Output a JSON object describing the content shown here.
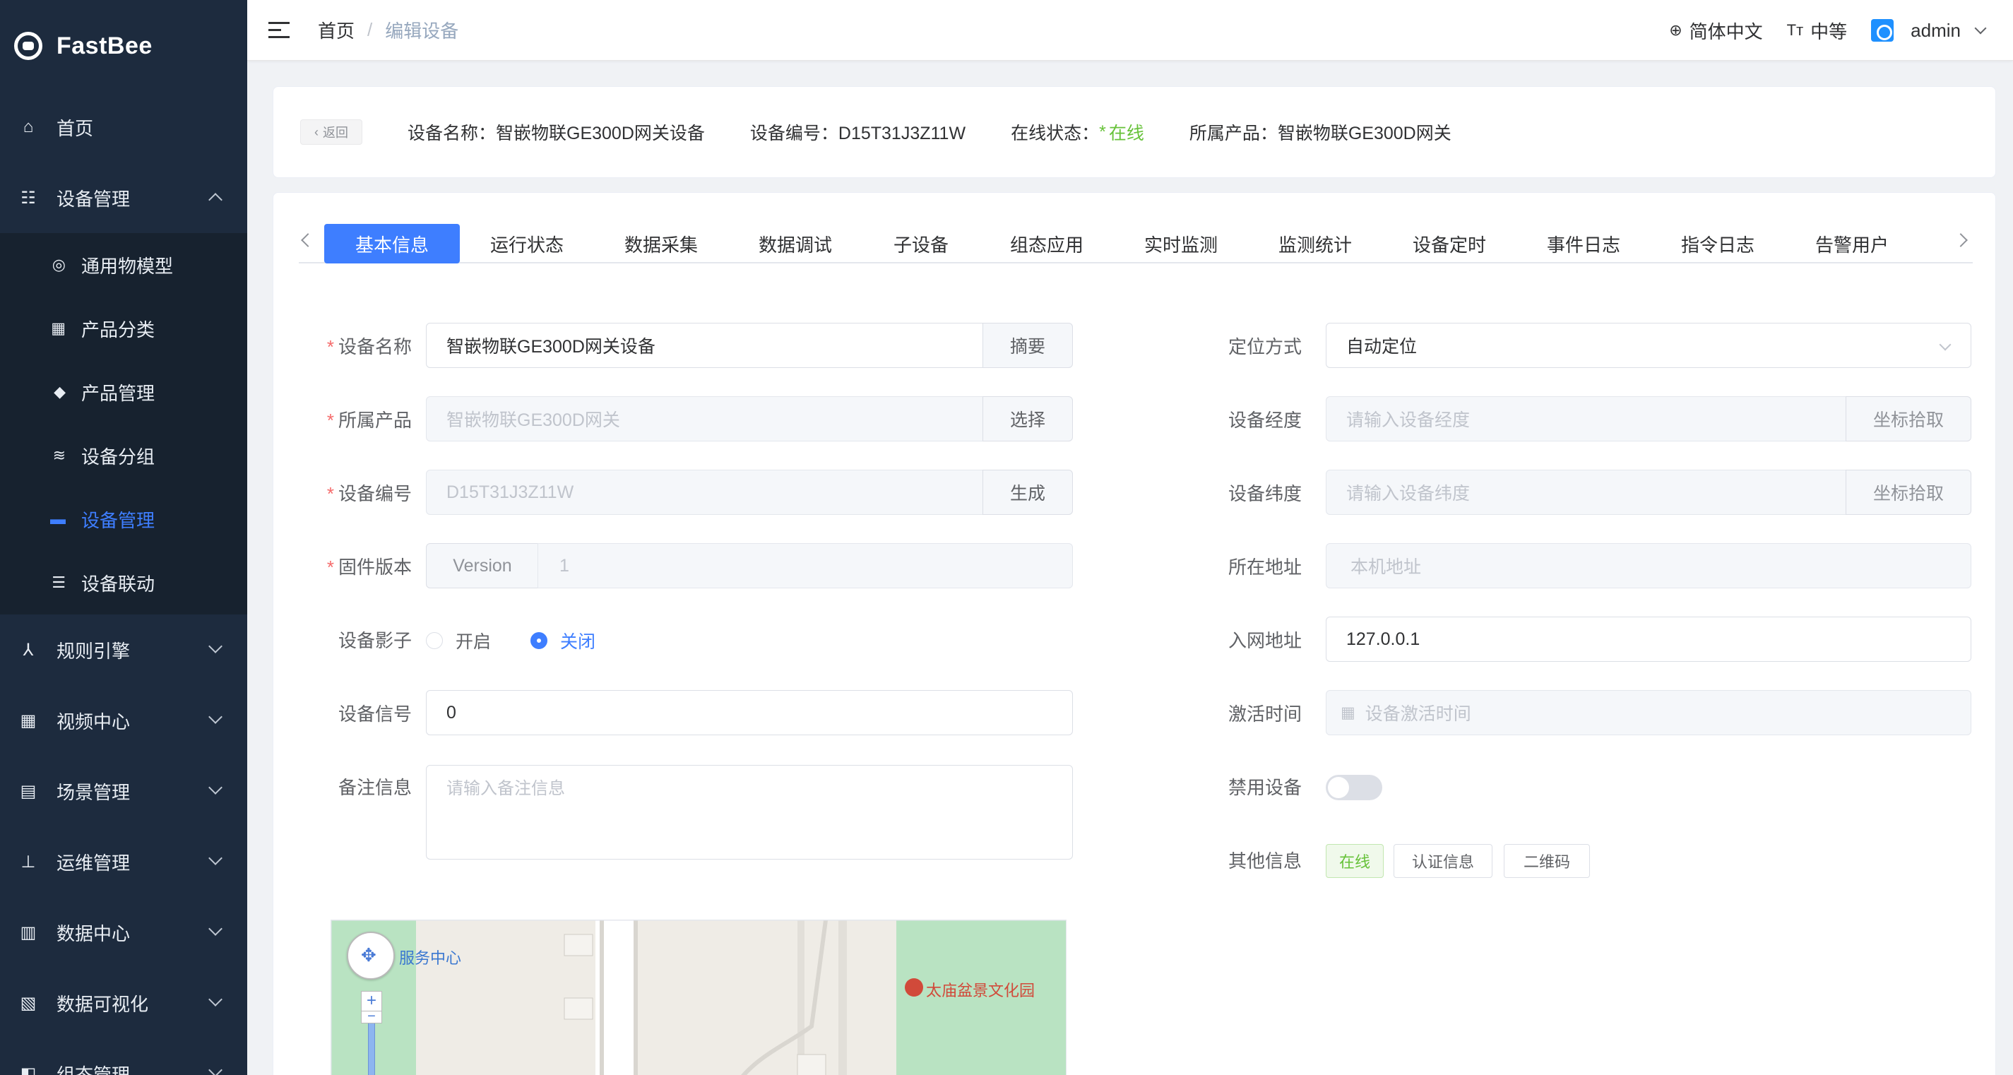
{
  "app": {
    "name": "FastBee"
  },
  "sidebar": {
    "items": [
      {
        "label": "首页",
        "icon": "home-icon"
      },
      {
        "label": "设备管理",
        "icon": "device-icon",
        "expanded": true
      },
      {
        "label": "通用物模型",
        "icon": "model-icon"
      },
      {
        "label": "产品分类",
        "icon": "category-icon"
      },
      {
        "label": "产品管理",
        "icon": "box-icon"
      },
      {
        "label": "设备分组",
        "icon": "layers-icon"
      },
      {
        "label": "设备管理",
        "icon": "device-manage-icon",
        "active": true
      },
      {
        "label": "设备联动",
        "icon": "list-icon"
      },
      {
        "label": "规则引擎",
        "icon": "rule-icon"
      },
      {
        "label": "视频中心",
        "icon": "video-icon"
      },
      {
        "label": "场景管理",
        "icon": "scene-icon"
      },
      {
        "label": "运维管理",
        "icon": "ops-icon"
      },
      {
        "label": "数据中心",
        "icon": "data-icon"
      },
      {
        "label": "数据可视化",
        "icon": "visual-icon"
      },
      {
        "label": "组态管理",
        "icon": "config-icon"
      }
    ]
  },
  "header": {
    "breadcrumb": {
      "home": "首页",
      "current": "编辑设备"
    },
    "language": "简体中文",
    "font_size": "中等",
    "user": "admin"
  },
  "info": {
    "back": "返回",
    "device_name": "设备名称：智嵌物联GE300D网关设备",
    "device_code": "设备编号：D15T31J3Z11W",
    "online_label": "在线状态：",
    "online_value": "在线",
    "product": "所属产品：智嵌物联GE300D网关"
  },
  "tabs": [
    "基本信息",
    "运行状态",
    "数据采集",
    "数据调试",
    "子设备",
    "组态应用",
    "实时监测",
    "监测统计",
    "设备定时",
    "事件日志",
    "指令日志",
    "告警用户"
  ],
  "form_left": {
    "device_name_label": "设备名称",
    "device_name_value": "智嵌物联GE300D网关设备",
    "summary_btn": "摘要",
    "product_label": "所属产品",
    "product_value": "智嵌物联GE300D网关",
    "select_btn": "选择",
    "serial_label": "设备编号",
    "serial_value": "D15T31J3Z11W",
    "generate_btn": "生成",
    "firmware_label": "固件版本",
    "firmware_prefix": "Version",
    "firmware_value": "1",
    "shadow_label": "设备影子",
    "shadow_on": "开启",
    "shadow_off": "关闭",
    "signal_label": "设备信号",
    "signal_value": "0",
    "remark_label": "备注信息",
    "remark_placeholder": "请输入备注信息"
  },
  "form_right": {
    "locate_label": "定位方式",
    "locate_value": "自动定位",
    "lng_label": "设备经度",
    "lng_placeholder": "请输入设备经度",
    "lat_label": "设备纬度",
    "lat_placeholder": "请输入设备纬度",
    "pick_btn": "坐标拾取",
    "address_label": "所在地址",
    "address_placeholder": "本机地址",
    "ip_label": "入网地址",
    "ip_value": "127.0.0.1",
    "active_label": "激活时间",
    "active_placeholder": "设备激活时间",
    "disable_label": "禁用设备",
    "other_label": "其他信息",
    "btn_online": "在线",
    "btn_auth": "认证信息",
    "btn_qr": "二维码"
  },
  "map": {
    "label_service": "服务中心",
    "label_park": "太庙盆景文化园"
  }
}
